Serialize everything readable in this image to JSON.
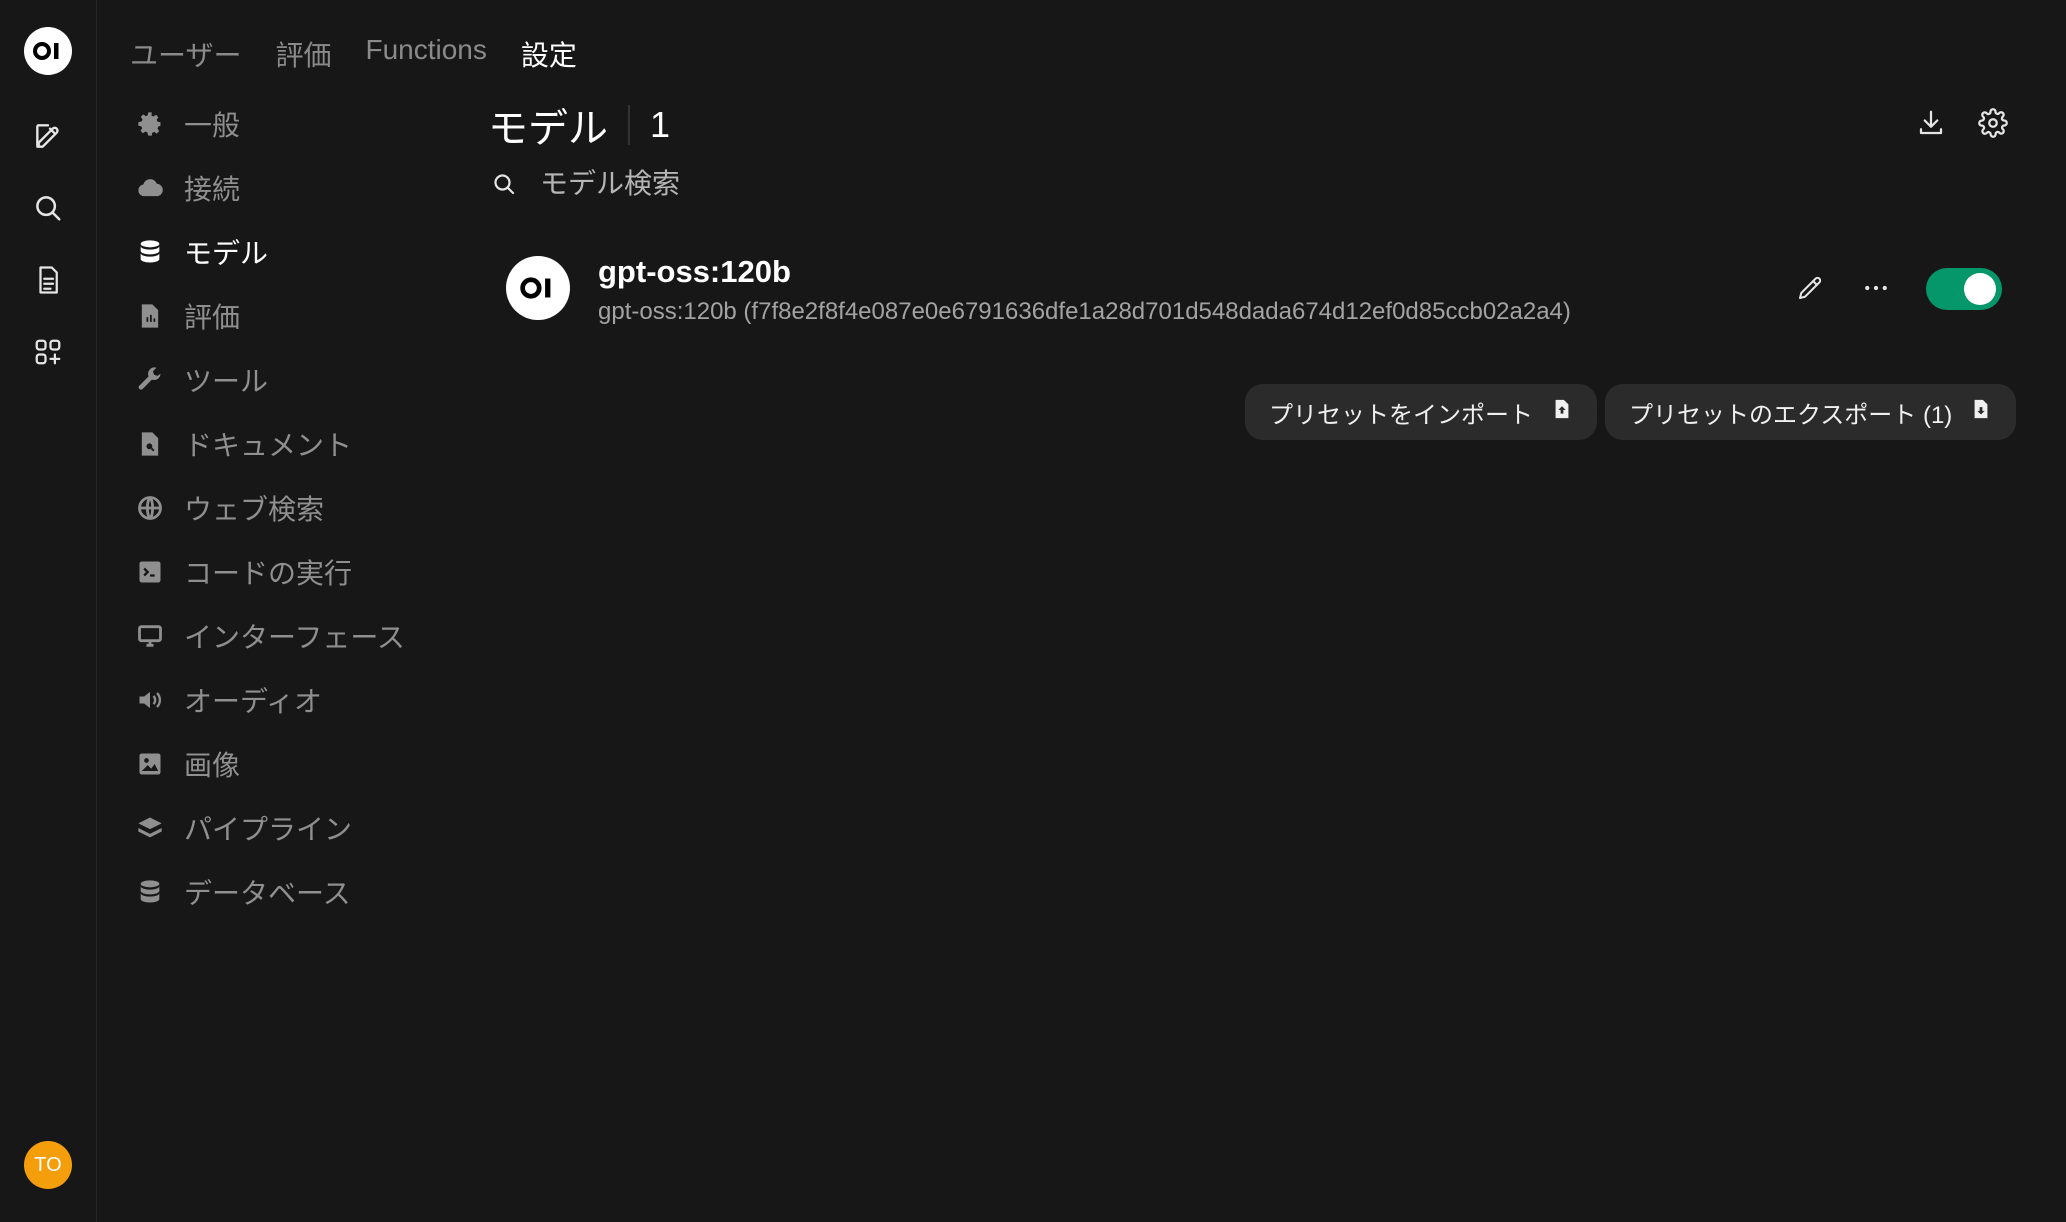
{
  "rail": {
    "logo_text": "OI",
    "avatar_initials": "TO",
    "icons": [
      "new-chat-icon",
      "search-icon",
      "notes-icon",
      "workspace-icon"
    ]
  },
  "topnav": {
    "tabs": [
      "ユーザー",
      "評価",
      "Functions",
      "設定"
    ],
    "active": "設定"
  },
  "settings_nav": {
    "items": [
      {
        "label": "一般",
        "icon": "gear-icon"
      },
      {
        "label": "接続",
        "icon": "cloud-icon"
      },
      {
        "label": "モデル",
        "icon": "database-icon",
        "active": true
      },
      {
        "label": "評価",
        "icon": "document-chart-icon"
      },
      {
        "label": "ツール",
        "icon": "wrench-icon"
      },
      {
        "label": "ドキュメント",
        "icon": "document-search-icon"
      },
      {
        "label": "ウェブ検索",
        "icon": "globe-icon"
      },
      {
        "label": "コードの実行",
        "icon": "terminal-icon"
      },
      {
        "label": "インターフェース",
        "icon": "monitor-icon"
      },
      {
        "label": "オーディオ",
        "icon": "speaker-icon"
      },
      {
        "label": "画像",
        "icon": "image-icon"
      },
      {
        "label": "パイプライン",
        "icon": "layers-icon"
      },
      {
        "label": "データベース",
        "icon": "database-icon"
      }
    ]
  },
  "main": {
    "title": "モデル",
    "count": "1",
    "search_placeholder": "モデル検索",
    "model": {
      "logo_text": "OI",
      "name": "gpt-oss:120b",
      "description": "gpt-oss:120b (f7f8e2f8f4e087e0e6791636dfe1a28d701d548dada674d12ef0d85ccb02a2a4)",
      "enabled": true
    },
    "import_preset_label": "プリセットをインポート",
    "export_preset_label": "プリセットのエクスポート (1)"
  },
  "colors": {
    "background": "#171717",
    "toggle_on": "#059669",
    "avatar": "#f59e0b"
  }
}
